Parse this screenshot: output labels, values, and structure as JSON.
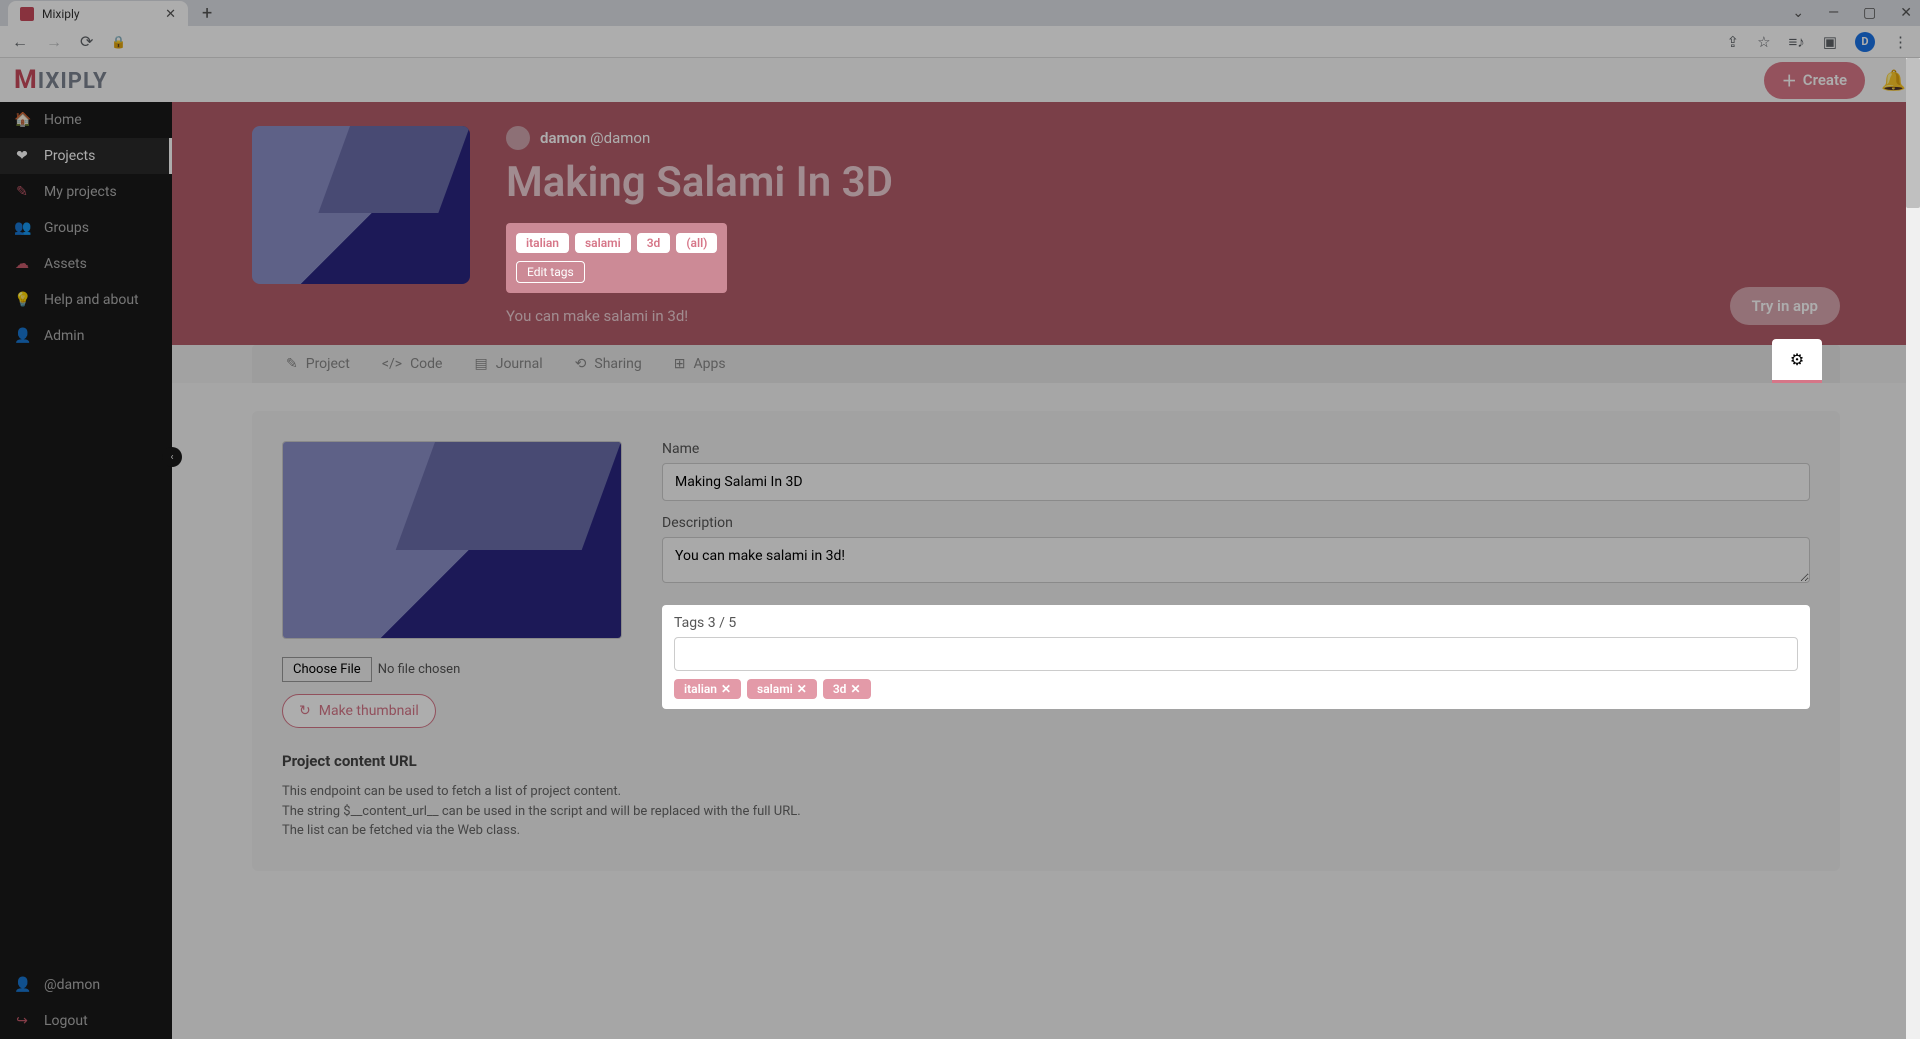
{
  "browser": {
    "tab_title": "Mixiply",
    "controls": {
      "min": "—",
      "max": "▢",
      "close": "✕"
    },
    "avatar_letter": "D"
  },
  "app": {
    "logo_m": "M",
    "logo_rest": "IXIPLY",
    "create_label": "Create"
  },
  "sidebar": {
    "items": [
      {
        "icon": "🏠",
        "label": "Home"
      },
      {
        "icon": "❤",
        "label": "Projects"
      },
      {
        "icon": "✎",
        "label": "My projects"
      },
      {
        "icon": "👥",
        "label": "Groups"
      },
      {
        "icon": "☁",
        "label": "Assets"
      },
      {
        "icon": "💡",
        "label": "Help and about"
      },
      {
        "icon": "👤",
        "label": "Admin"
      }
    ],
    "bottom": [
      {
        "icon": "👤",
        "label": "@damon"
      },
      {
        "icon": "↪",
        "label": "Logout"
      }
    ]
  },
  "hero": {
    "user_display": "damon",
    "user_handle": "@damon",
    "title": "Making Salami In 3D",
    "tags": [
      "italian",
      "salami",
      "3d",
      "(all)"
    ],
    "edit_tags_label": "Edit tags",
    "description": "You can make salami in 3d!",
    "try_label": "Try in app"
  },
  "tabs": [
    {
      "icon": "✎",
      "label": "Project"
    },
    {
      "icon": "</>",
      "label": "Code"
    },
    {
      "icon": "▤",
      "label": "Journal"
    },
    {
      "icon": "⟲",
      "label": "Sharing"
    },
    {
      "icon": "⊞",
      "label": "Apps"
    }
  ],
  "settings": {
    "name_label": "Name",
    "name_value": "Making Salami In 3D",
    "desc_label": "Description",
    "desc_value": "You can make salami in 3d!",
    "choose_file_label": "Choose File",
    "no_file_text": "No file chosen",
    "make_thumb_label": "Make thumbnail",
    "tags_header": "Tags 3 / 5",
    "tags": [
      "italian",
      "salami",
      "3d"
    ],
    "content_url_title": "Project content URL",
    "content_url_lines": [
      "This endpoint can be used to fetch a list of project content.",
      "The string $__content_url__ can be used in the script and will be replaced with the full URL.",
      "The list can be fetched via the Web class."
    ]
  }
}
